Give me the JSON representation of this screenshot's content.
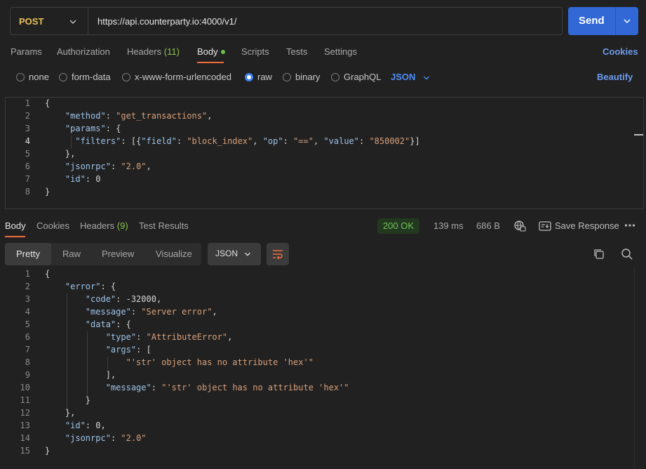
{
  "request": {
    "method": "POST",
    "url": "https://api.counterparty.io:4000/v1/",
    "send_label": "Send"
  },
  "request_tabs": {
    "params": "Params",
    "authorization": "Authorization",
    "headers_label": "Headers",
    "headers_count": "(11)",
    "body": "Body",
    "scripts": "Scripts",
    "tests": "Tests",
    "settings": "Settings",
    "cookies": "Cookies"
  },
  "body_types": {
    "none": "none",
    "form_data": "form-data",
    "urlencoded": "x-www-form-urlencoded",
    "raw": "raw",
    "binary": "binary",
    "graphql": "GraphQL",
    "format": "JSON",
    "beautify": "Beautify"
  },
  "request_body_lines": [
    "{",
    "    \"method\": \"get_transactions\",",
    "    \"params\": {",
    "      \"filters\": [{\"field\": \"block_index\", \"op\": \"==\", \"value\": \"850002\"}]",
    "    },",
    "    \"jsonrpc\": \"2.0\",",
    "    \"id\": 0",
    "}"
  ],
  "response_tabs": {
    "body": "Body",
    "cookies": "Cookies",
    "headers_label": "Headers",
    "headers_count": "(9)",
    "test_results": "Test Results"
  },
  "response_meta": {
    "status": "200 OK",
    "time": "139 ms",
    "size": "686 B",
    "save_response": "Save Response"
  },
  "response_view": {
    "pretty": "Pretty",
    "raw": "Raw",
    "preview": "Preview",
    "visualize": "Visualize",
    "format": "JSON"
  },
  "response_body_lines": [
    "{",
    "    \"error\": {",
    "        \"code\": -32000,",
    "        \"message\": \"Server error\",",
    "        \"data\": {",
    "            \"type\": \"AttributeError\",",
    "            \"args\": [",
    "                \"'str' object has no attribute 'hex'\"",
    "            ],",
    "            \"message\": \"'str' object has no attribute 'hex'\"",
    "        }",
    "    },",
    "    \"id\": 0,",
    "    \"jsonrpc\": \"2.0\"",
    "}"
  ],
  "colors": {
    "accent": "#3168d6",
    "method": "#e9c15a",
    "active_tab": "#f26b3a",
    "status_ok": "#72c25a",
    "link": "#6c9cec"
  }
}
